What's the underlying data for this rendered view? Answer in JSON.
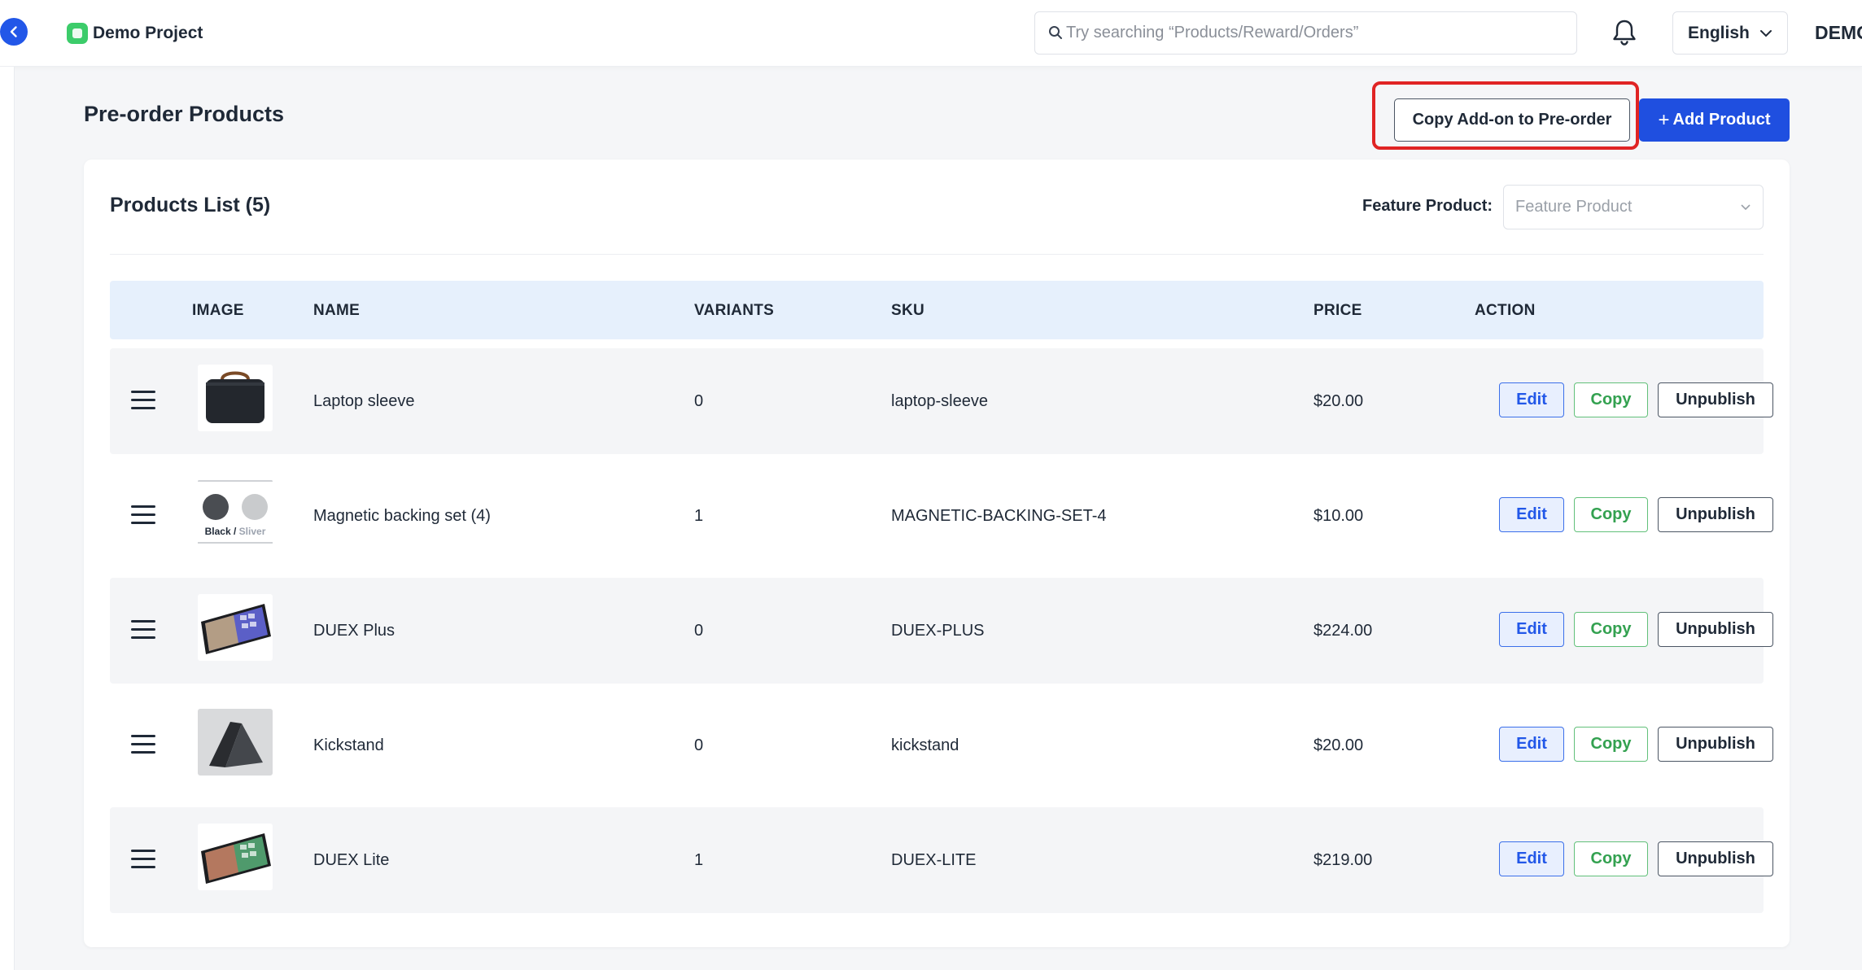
{
  "header": {
    "project_name": "Demo Project",
    "search_placeholder": "Try searching “Products/Reward/Orders”",
    "language": "English",
    "user": "DEMO"
  },
  "page": {
    "title": "Pre-order Products",
    "copy_addon_label": "Copy Add-on to Pre-order",
    "add_product_label": "Add Product",
    "add_product_icon": "+"
  },
  "list": {
    "title": "Products List (5)",
    "feature_label": "Feature Product:",
    "feature_placeholder": "Feature Product",
    "columns": {
      "image": "IMAGE",
      "name": "NAME",
      "variants": "VARIANTS",
      "sku": "SKU",
      "price": "PRICE",
      "action": "ACTION"
    },
    "actions": {
      "edit": "Edit",
      "copy": "Copy",
      "unpublish": "Unpublish"
    },
    "rows": [
      {
        "name": "Laptop sleeve",
        "variants": "0",
        "sku": "laptop-sleeve",
        "price": "$20.00",
        "image": "laptop-sleeve-image"
      },
      {
        "name": "Magnetic backing set (4)",
        "variants": "1",
        "sku": "MAGNETIC-BACKING-SET-4",
        "price": "$10.00",
        "image": "magnetic-backing-image",
        "image_caption_a": "Black",
        "image_caption_sep": "/",
        "image_caption_b": "Sliver"
      },
      {
        "name": "DUEX Plus",
        "variants": "0",
        "sku": "DUEX-PLUS",
        "price": "$224.00",
        "image": "duex-plus-image"
      },
      {
        "name": "Kickstand",
        "variants": "0",
        "sku": "kickstand",
        "price": "$20.00",
        "image": "kickstand-image"
      },
      {
        "name": "DUEX Lite",
        "variants": "1",
        "sku": "DUEX-LITE",
        "price": "$219.00",
        "image": "duex-lite-image"
      }
    ]
  },
  "colors": {
    "primary": "#1f4fe0",
    "highlight": "#e02424",
    "copy_green": "#33a150",
    "table_header": "#e6f0fc"
  }
}
